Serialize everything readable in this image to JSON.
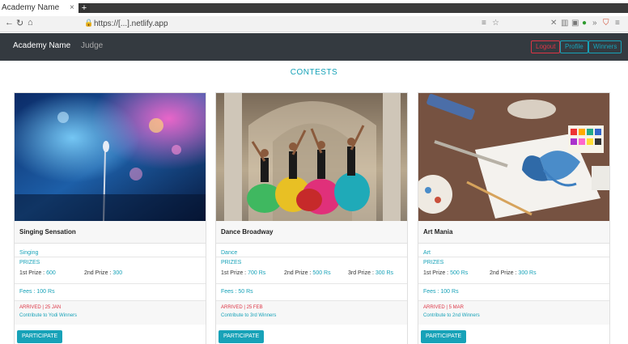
{
  "browser": {
    "tab_title": "Academy Name",
    "tab_close": "×",
    "new_tab": "+",
    "url": "https://[...].netlify.app"
  },
  "navbar": {
    "brand": "Academy Name",
    "link": "Judge",
    "buttons": [
      "Logout",
      "Profile",
      "Winners"
    ]
  },
  "page": {
    "heading": "CONTESTS"
  },
  "cards": [
    {
      "title": "Singing Sensation",
      "category": "Singing",
      "prizes_label": "PRIZES",
      "prizes": [
        {
          "label": "1st Prize :",
          "value": "600"
        },
        {
          "label": "2nd Prize :",
          "value": "300"
        }
      ],
      "fees": "Fees : 100 Rs",
      "deadline": "ARRIVED | 25 JAN",
      "contribution": "Contribute to Yodi Winners",
      "button": "PARTICIPATE"
    },
    {
      "title": "Dance Broadway",
      "category": "Dance",
      "prizes_label": "PRIZES",
      "prizes": [
        {
          "label": "1st Prize :",
          "value": "700 Rs"
        },
        {
          "label": "2nd Prize :",
          "value": "500 Rs"
        },
        {
          "label": "3rd Prize :",
          "value": "300 Rs"
        }
      ],
      "fees": "Fees : 50 Rs",
      "deadline": "ARRIVED | 25 FEB",
      "contribution": "Contribute to 3rd Winners",
      "button": "PARTICIPATE"
    },
    {
      "title": "Art Mania",
      "category": "Art",
      "prizes_label": "PRIZES",
      "prizes": [
        {
          "label": "1st Prize :",
          "value": "500 Rs"
        },
        {
          "label": "2nd Prize :",
          "value": "300 Rs"
        }
      ],
      "fees": "Fees : 100 Rs",
      "deadline": "ARRIVED | 5 MAR",
      "contribution": "Contribute to 2nd Winners",
      "button": "PARTICIPATE"
    }
  ]
}
